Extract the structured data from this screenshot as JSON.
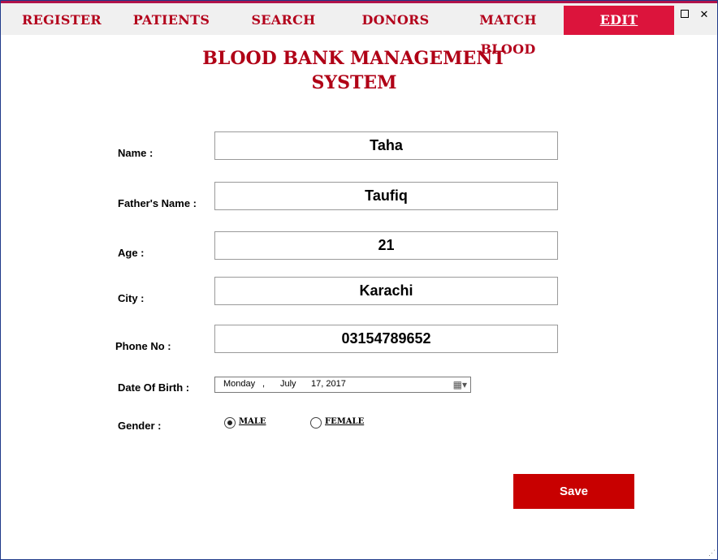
{
  "nav": {
    "items": [
      {
        "label": "REGISTER"
      },
      {
        "label": "PATIENTS"
      },
      {
        "label": "SEARCH"
      },
      {
        "label": "DONORS"
      },
      {
        "label": "MATCH BLOOD"
      },
      {
        "label": "EDIT",
        "active": true
      }
    ]
  },
  "window_controls": {
    "maximize": "maximize-icon",
    "close": "✕"
  },
  "title_line1": "BLOOD BANK MANAGEMENT",
  "title_line2": "SYSTEM",
  "form": {
    "name_label": "Name :",
    "name_value": "Taha",
    "father_label": "Father's Name :",
    "father_value": "Taufiq",
    "age_label": "Age :",
    "age_value": "21",
    "city_label": "City :",
    "city_value": "Karachi",
    "phone_label": "Phone No :",
    "phone_value": "03154789652",
    "dob_label": "Date Of Birth :",
    "dob_weekday": "Monday",
    "dob_sep": ",",
    "dob_month": "July",
    "dob_dayyear": "17, 2017",
    "dob_button": "▦▾",
    "gender_label": "Gender :",
    "gender_options": [
      {
        "label": "MALE",
        "checked": true
      },
      {
        "label": "FEMALE",
        "checked": false
      }
    ]
  },
  "save_label": "Save",
  "colors": {
    "accent": "#dc143c",
    "nav_text": "#b3001b",
    "title": "#b00016",
    "save": "#c80000"
  }
}
